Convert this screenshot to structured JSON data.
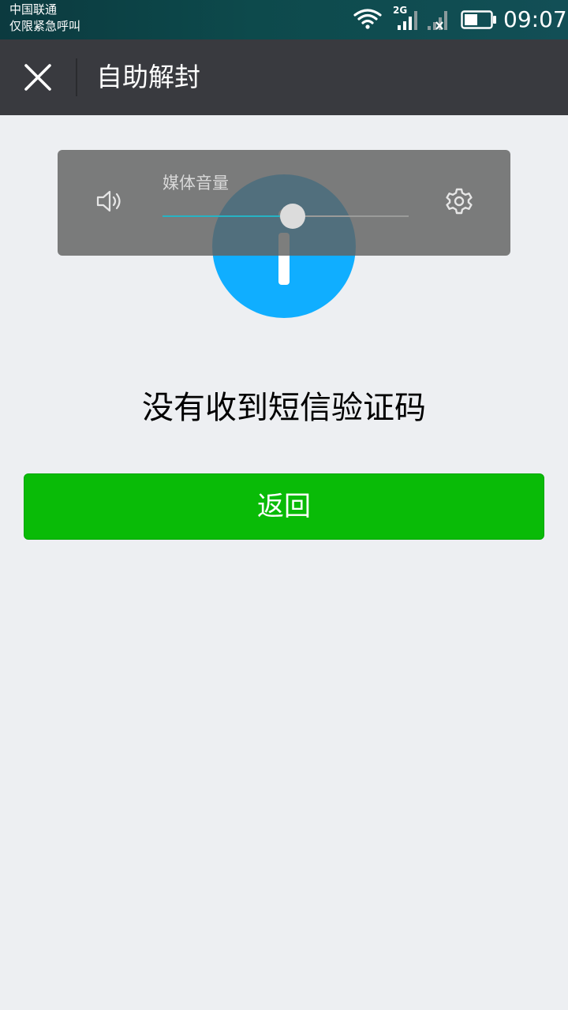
{
  "status_bar": {
    "carrier": "中国联通",
    "emergency": "仅限紧急呼叫",
    "network_type": "2G",
    "time": "09:07",
    "battery_level": 0.5,
    "icons": [
      "wifi-icon",
      "signal-2g-icon",
      "signal-no-service-icon",
      "battery-icon"
    ]
  },
  "title_bar": {
    "title": "自助解封",
    "close_icon": "close-icon"
  },
  "volume_overlay": {
    "label": "媒体音量",
    "level": 0.53,
    "speaker_icon": "speaker-icon",
    "settings_icon": "gear-icon"
  },
  "main": {
    "status_icon": "info-icon",
    "message": "没有收到短信验证码",
    "back_button_label": "返回"
  },
  "colors": {
    "title_bar_bg": "#393a3f",
    "page_bg": "#edeff2",
    "info_blue": "#10aeff",
    "button_green": "#09bb07",
    "slider_accent": "#26b3c4"
  }
}
